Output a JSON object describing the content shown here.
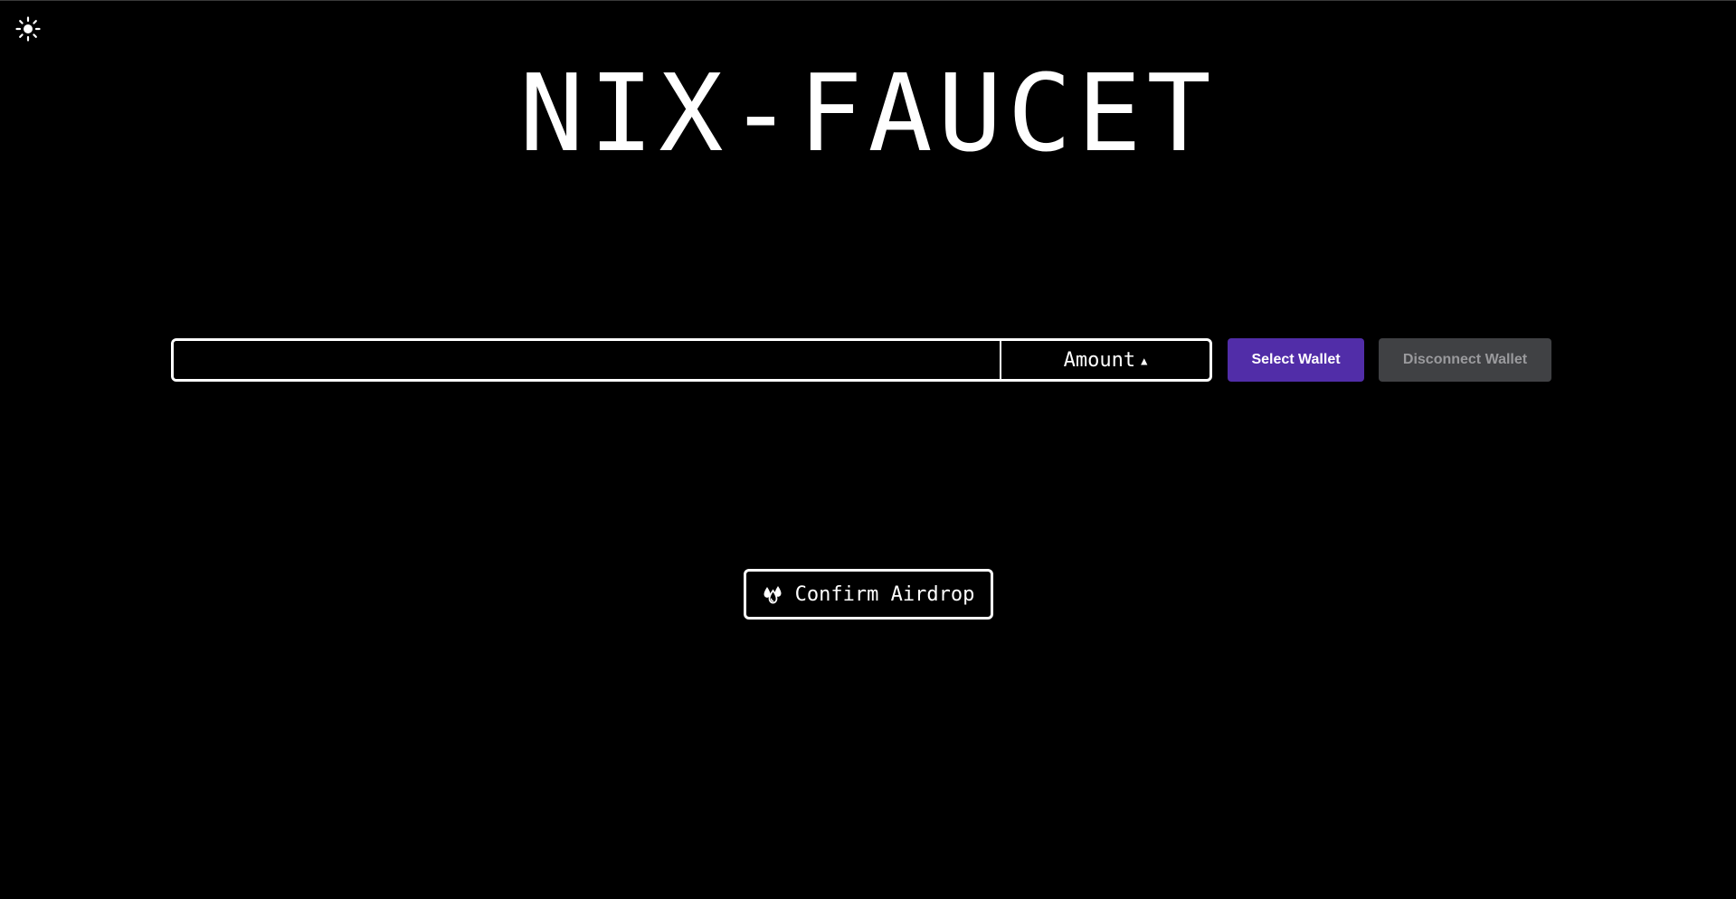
{
  "header": {
    "theme_toggle_icon": "sun-icon",
    "title": "NIX-FAUCET"
  },
  "form": {
    "address_input": {
      "value": "",
      "placeholder": ""
    },
    "amount_select": {
      "label": "Amount",
      "icon": "chevron-up-icon"
    },
    "select_wallet_label": "Select Wallet",
    "disconnect_wallet_label": "Disconnect Wallet"
  },
  "actions": {
    "confirm_airdrop_label": "Confirm Airdrop",
    "confirm_airdrop_icon": "droplets-icon"
  },
  "colors": {
    "background": "#000000",
    "foreground": "#ffffff",
    "accent": "#512da8",
    "disabled_bg": "#404144",
    "disabled_text": "#9a9a9d"
  }
}
